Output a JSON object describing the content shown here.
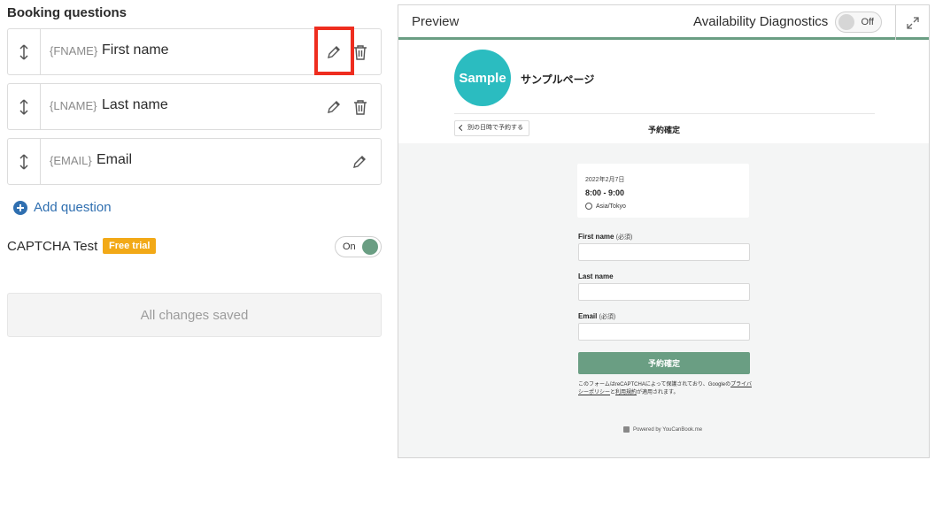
{
  "left": {
    "section_title": "Booking questions",
    "questions": [
      {
        "token": "{FNAME}",
        "label": "First name"
      },
      {
        "token": "{LNAME}",
        "label": "Last name"
      },
      {
        "token": "{EMAIL}",
        "label": "Email"
      }
    ],
    "add_question": "Add question",
    "captcha_label": "CAPTCHA Test",
    "free_badge": "Free trial",
    "captcha_toggle": "On",
    "save_status": "All changes saved"
  },
  "preview": {
    "title": "Preview",
    "diagnostics_label": "Availability Diagnostics",
    "diagnostics_toggle": "Off",
    "page": {
      "logo_text": "Sample",
      "site_name": "サンプルページ",
      "back_label": "別の日時で予約する",
      "confirm_title": "予約確定",
      "date": "2022年2月7日",
      "time": "8:00 - 9:00",
      "timezone": "Asia/Tokyo",
      "fields": [
        {
          "label": "First name",
          "req": "(必須)"
        },
        {
          "label": "Last name",
          "req": ""
        },
        {
          "label": "Email",
          "req": "(必須)"
        }
      ],
      "submit": "予約確定",
      "captcha_note_1": "このフォームはreCAPTCHAによって保護されており、Googleの",
      "captcha_link_1": "プライバシーポリシー",
      "captcha_note_2": "と",
      "captcha_link_2": "利用規約",
      "captcha_note_3": "が適用されます。",
      "powered_by": "Powered by YouCanBook.me"
    }
  },
  "colors": {
    "accent": "#6a9e83",
    "link": "#2f6fb0",
    "badge": "#f2a917",
    "highlight": "#ee2d1f",
    "logo": "#2bbcc0"
  }
}
